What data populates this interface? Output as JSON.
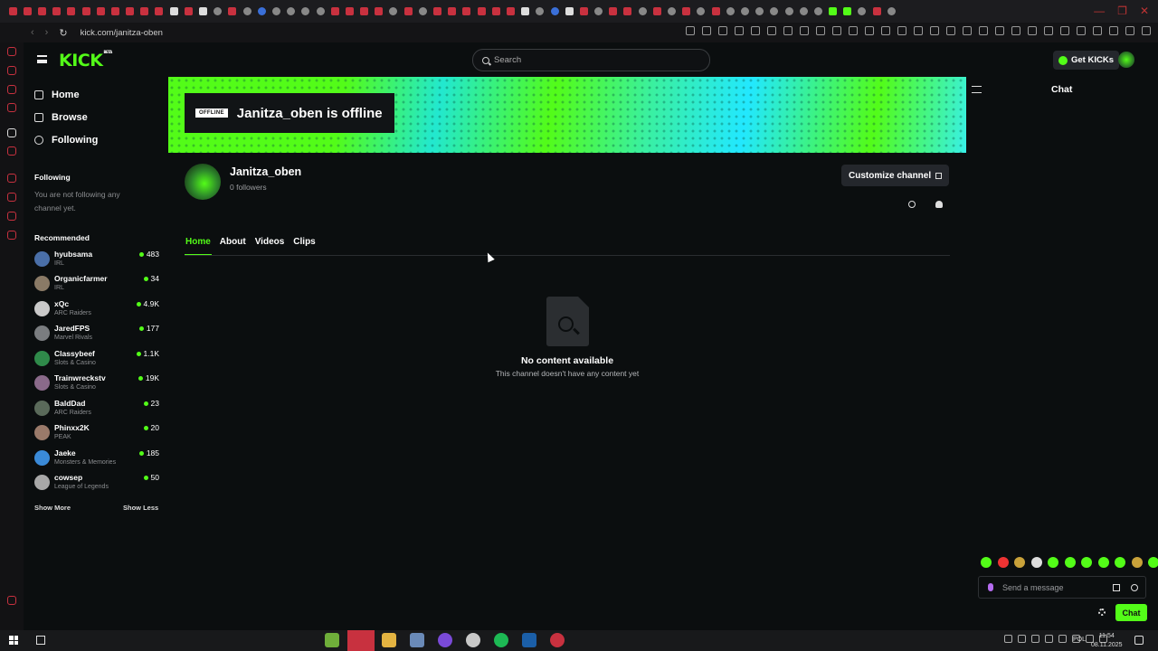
{
  "browser": {
    "url": "kick.com/janitza-oben"
  },
  "header": {
    "logo": "KICK",
    "logo_badge": "BETA",
    "search_placeholder": "Search",
    "get_kicks": "Get KICKs"
  },
  "sidebar": {
    "nav": [
      {
        "label": "Home",
        "icon": "home-icon"
      },
      {
        "label": "Browse",
        "icon": "browse-icon"
      },
      {
        "label": "Following",
        "icon": "heart-icon"
      }
    ],
    "following_title": "Following",
    "following_note": "You are not following any channel yet.",
    "recommended_title": "Recommended",
    "recommended": [
      {
        "name": "hyubsama",
        "category": "IRL",
        "viewers": "483"
      },
      {
        "name": "Organicfarmer",
        "category": "IRL",
        "viewers": "34"
      },
      {
        "name": "xQc",
        "category": "ARC Raiders",
        "viewers": "4.9K"
      },
      {
        "name": "JaredFPS",
        "category": "Marvel Rivals",
        "viewers": "177"
      },
      {
        "name": "Classybeef",
        "category": "Slots & Casino",
        "viewers": "1.1K"
      },
      {
        "name": "Trainwreckstv",
        "category": "Slots & Casino",
        "viewers": "19K"
      },
      {
        "name": "BaldDad",
        "category": "ARC Raiders",
        "viewers": "23"
      },
      {
        "name": "Phinxx2K",
        "category": "PEAK",
        "viewers": "20"
      },
      {
        "name": "Jaeke",
        "category": "Monsters & Memories",
        "viewers": "185"
      },
      {
        "name": "cowsep",
        "category": "League of Legends",
        "viewers": "50"
      }
    ],
    "show_more": "Show More",
    "show_less": "Show Less"
  },
  "channel": {
    "offline_badge": "OFFLINE",
    "offline_text": "Janitza_oben is offline",
    "name": "Janitza_oben",
    "followers": "0 followers",
    "customize": "Customize channel",
    "tabs": [
      "Home",
      "About",
      "Videos",
      "Clips"
    ],
    "empty_title": "No content available",
    "empty_subtitle": "This channel doesn't have any content yet"
  },
  "chat": {
    "title": "Chat",
    "placeholder": "Send a message",
    "button": "Chat"
  },
  "taskbar": {
    "language": "POL",
    "time": "11:54",
    "date": "08.11.2025"
  },
  "colors": {
    "accent": "#53fc18",
    "background": "#0b0e0f"
  }
}
